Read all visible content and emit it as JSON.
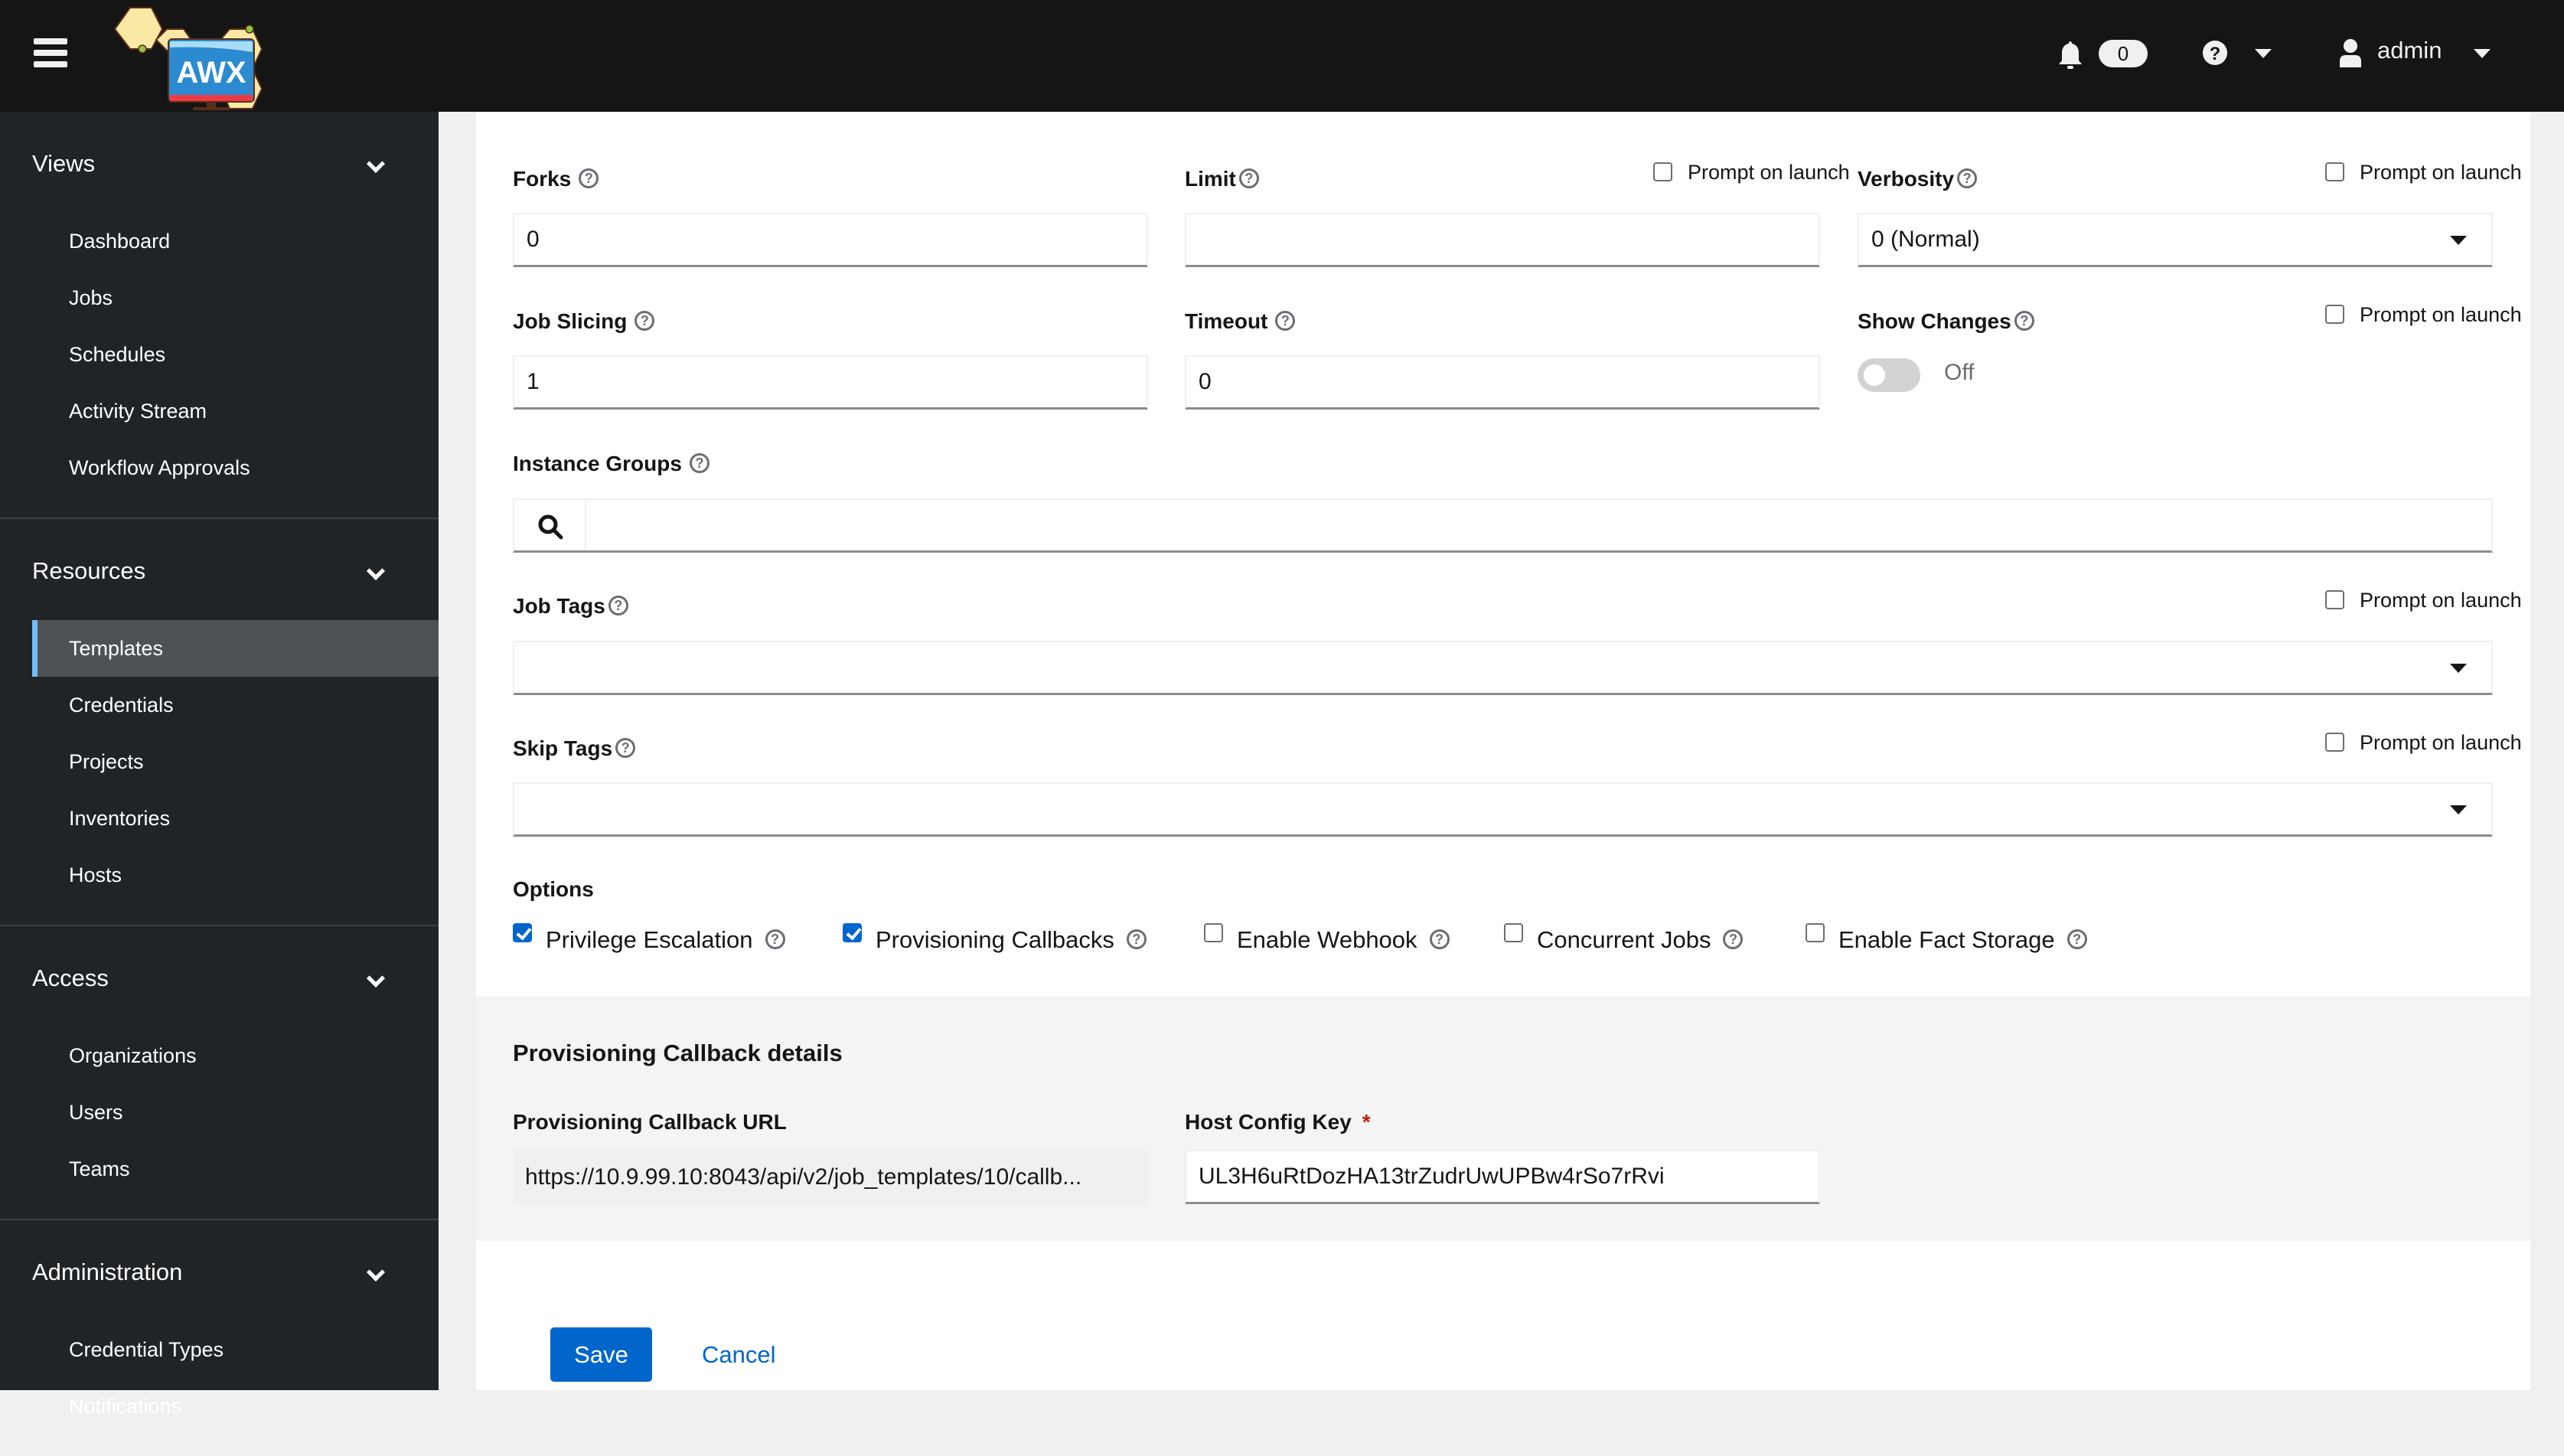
{
  "header": {
    "logo_text": "AWX",
    "notification_count": "0",
    "username": "admin"
  },
  "sidebar": {
    "groups": [
      {
        "title": "Views",
        "items": [
          "Dashboard",
          "Jobs",
          "Schedules",
          "Activity Stream",
          "Workflow Approvals"
        ]
      },
      {
        "title": "Resources",
        "items": [
          "Templates",
          "Credentials",
          "Projects",
          "Inventories",
          "Hosts"
        ],
        "active": "Templates"
      },
      {
        "title": "Access",
        "items": [
          "Organizations",
          "Users",
          "Teams"
        ]
      },
      {
        "title": "Administration",
        "items": [
          "Credential Types",
          "Notifications"
        ]
      }
    ]
  },
  "form": {
    "forks": {
      "label": "Forks",
      "value": "0"
    },
    "limit": {
      "label": "Limit",
      "value": "",
      "prompt_label": "Prompt on launch",
      "prompt_checked": false
    },
    "verbosity": {
      "label": "Verbosity",
      "value": "0 (Normal)",
      "prompt_label": "Prompt on launch",
      "prompt_checked": false
    },
    "job_slicing": {
      "label": "Job Slicing",
      "value": "1"
    },
    "timeout": {
      "label": "Timeout",
      "value": "0"
    },
    "show_changes": {
      "label": "Show Changes",
      "state_label": "Off",
      "on": false,
      "prompt_label": "Prompt on launch",
      "prompt_checked": false
    },
    "instance_groups": {
      "label": "Instance Groups",
      "value": ""
    },
    "job_tags": {
      "label": "Job Tags",
      "value": "",
      "prompt_label": "Prompt on launch",
      "prompt_checked": false
    },
    "skip_tags": {
      "label": "Skip Tags",
      "value": "",
      "prompt_label": "Prompt on launch",
      "prompt_checked": false
    },
    "options": {
      "label": "Options",
      "items": [
        {
          "label": "Privilege Escalation",
          "checked": true
        },
        {
          "label": "Provisioning Callbacks",
          "checked": true
        },
        {
          "label": "Enable Webhook",
          "checked": false
        },
        {
          "label": "Concurrent Jobs",
          "checked": false
        },
        {
          "label": "Enable Fact Storage",
          "checked": false
        }
      ]
    },
    "callback": {
      "title": "Provisioning Callback details",
      "url_label": "Provisioning Callback URL",
      "url_value": "https://10.9.99.10:8043/api/v2/job_templates/10/callb...",
      "key_label": "Host Config Key",
      "key_required_mark": "*",
      "key_value": "UL3H6uRtDozHA13trZudrUwUPBw4rSo7rRvi"
    },
    "save_label": "Save",
    "cancel_label": "Cancel"
  },
  "colors": {
    "primary": "#0066cc",
    "header_bg": "#151515",
    "sidebar_bg": "#212427",
    "active_indicator": "#73bcf7",
    "required": "#c9190b"
  }
}
